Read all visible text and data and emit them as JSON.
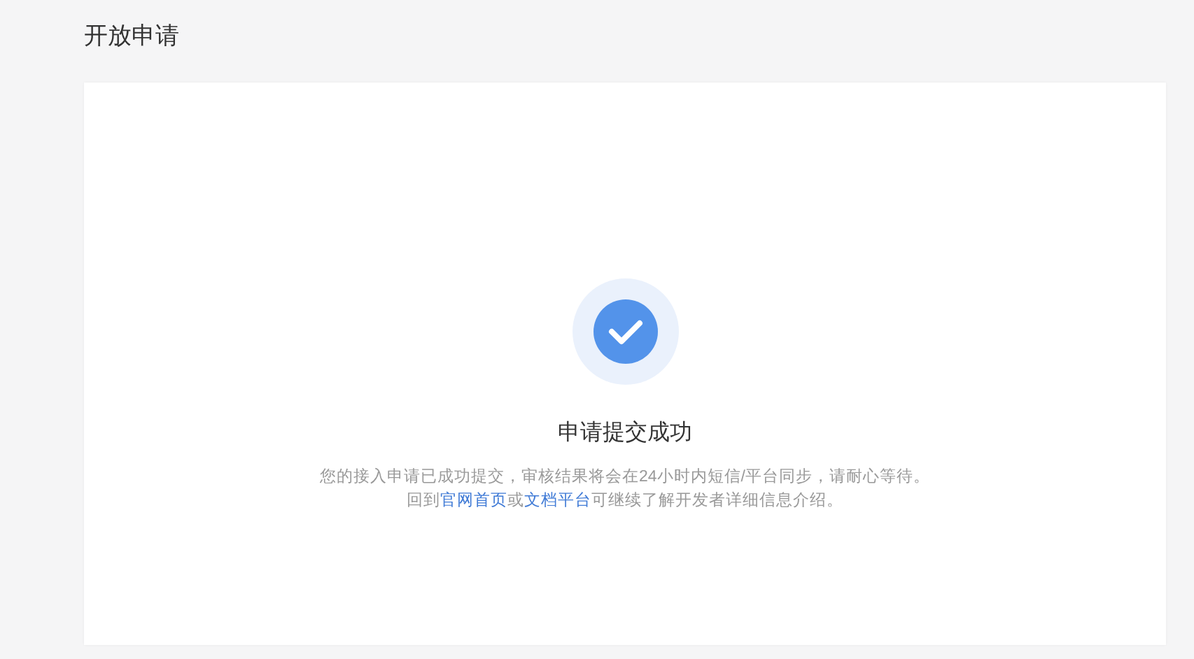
{
  "page_title": "开放申请",
  "result": {
    "title": "申请提交成功",
    "message": "您的接入申请已成功提交，审核结果将会在24小时内短信/平台同步，请耐心等待。",
    "help": [
      {
        "kind": "text",
        "text": "回到"
      },
      {
        "kind": "link",
        "text": "官网首页"
      },
      {
        "kind": "text",
        "text": "或"
      },
      {
        "kind": "link",
        "text": "文档平台"
      },
      {
        "kind": "text",
        "text": "可继续了解开发者详细信息介绍。"
      }
    ]
  }
}
